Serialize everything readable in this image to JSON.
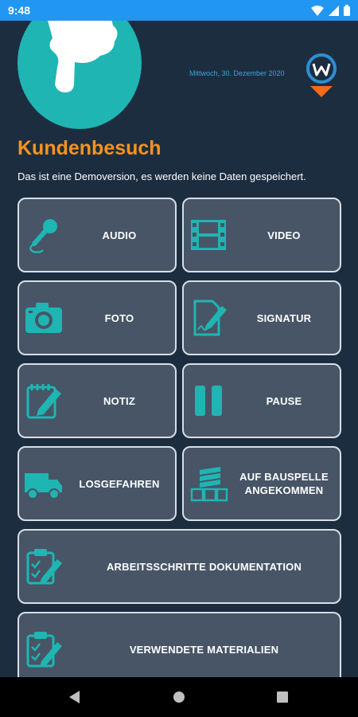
{
  "status_bar": {
    "time": "9:48"
  },
  "header": {
    "date": "Mittwoch, 30. Dezember 2020",
    "title": "Kundenbesuch",
    "subtitle": "Das ist eine Demoversion, es werden keine Daten gespeichert."
  },
  "tiles": [
    {
      "label": "AUDIO",
      "icon": "microphone-icon"
    },
    {
      "label": "VIDEO",
      "icon": "film-strip-icon"
    },
    {
      "label": "FOTO",
      "icon": "camera-icon"
    },
    {
      "label": "SIGNATUR",
      "icon": "signature-icon"
    },
    {
      "label": "NOTIZ",
      "icon": "note-pencil-icon"
    },
    {
      "label": "PAUSE",
      "icon": "pause-icon"
    },
    {
      "label": "LOSGEFAHREN",
      "icon": "truck-icon"
    },
    {
      "label": "AUF BAUSPELLE ANGEKOMMEN",
      "icon": "construction-materials-icon"
    },
    {
      "label": "ARBEITSSCHRITTE DOKUMENTATION",
      "icon": "clipboard-pencil-icon"
    },
    {
      "label": "VERWENDETE MATERIALIEN",
      "icon": "clipboard-pencil-icon"
    }
  ],
  "colors": {
    "background": "#1d2d40",
    "tile": "#475566",
    "icon": "#1fb5b3",
    "title": "#f7931e",
    "status_bar": "#2196f3"
  }
}
